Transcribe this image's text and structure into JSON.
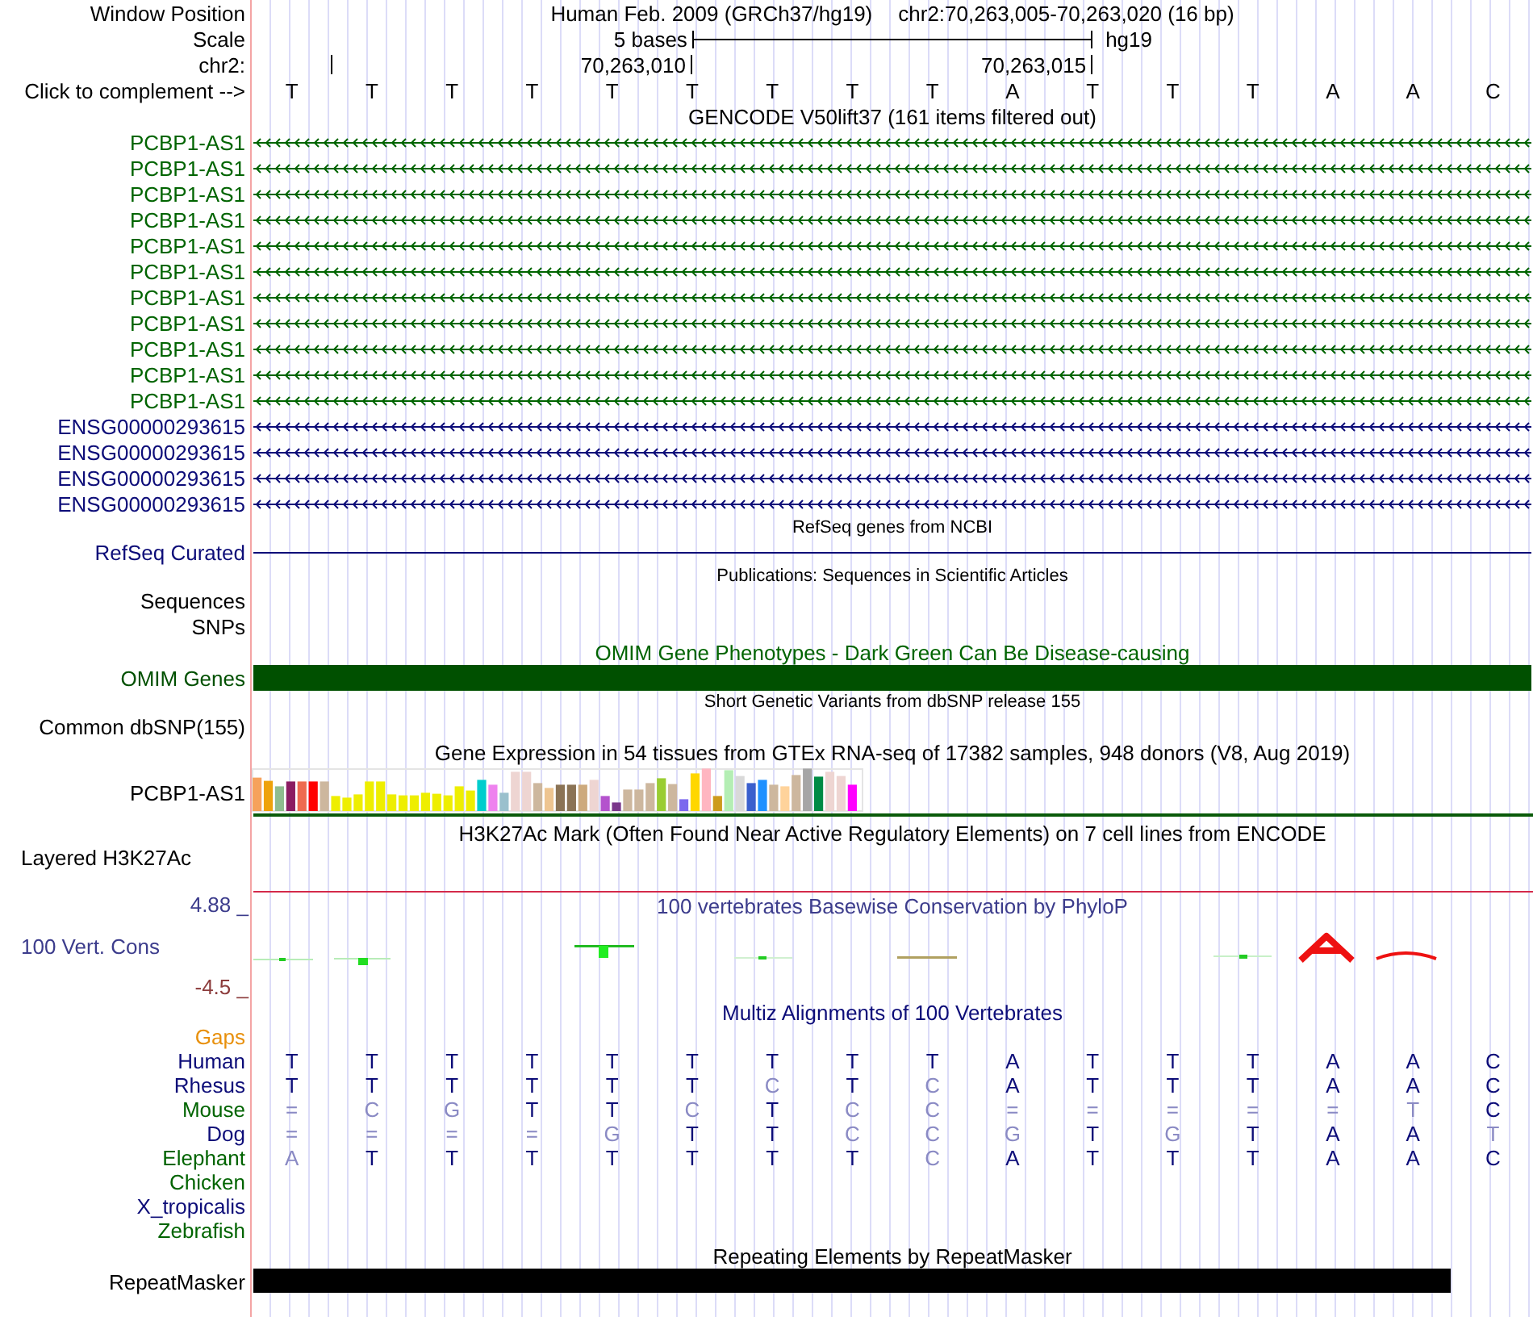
{
  "header": {
    "position_label": "Window Position",
    "assembly": "Human Feb. 2009 (GRCh37/hg19)",
    "position": "chr2:70,263,005-70,263,020 (16 bp)",
    "scale_label": "Scale",
    "scale_text": "5 bases",
    "scale_db": "hg19",
    "ruler_label": "chr2:",
    "ruler_marks": [
      "70,263,010",
      "70,263,015"
    ],
    "complement_label": "Click to complement -->",
    "bases": [
      "T",
      "T",
      "T",
      "T",
      "T",
      "T",
      "T",
      "T",
      "T",
      "A",
      "T",
      "T",
      "T",
      "A",
      "A",
      "C"
    ]
  },
  "tracks": [
    {
      "kind": "gene_list",
      "title": "GENCODE V50lift37 (161 items filtered out)",
      "color": "#000000",
      "rows": [
        {
          "name": "PCBP1-AS1",
          "color": "#006400"
        },
        {
          "name": "PCBP1-AS1",
          "color": "#006400"
        },
        {
          "name": "PCBP1-AS1",
          "color": "#006400"
        },
        {
          "name": "PCBP1-AS1",
          "color": "#006400"
        },
        {
          "name": "PCBP1-AS1",
          "color": "#006400"
        },
        {
          "name": "PCBP1-AS1",
          "color": "#006400"
        },
        {
          "name": "PCBP1-AS1",
          "color": "#006400"
        },
        {
          "name": "PCBP1-AS1",
          "color": "#006400"
        },
        {
          "name": "PCBP1-AS1",
          "color": "#006400"
        },
        {
          "name": "PCBP1-AS1",
          "color": "#006400"
        },
        {
          "name": "PCBP1-AS1",
          "color": "#006400"
        },
        {
          "name": "ENSG00000293615",
          "color": "#0c0c78"
        },
        {
          "name": "ENSG00000293615",
          "color": "#0c0c78"
        },
        {
          "name": "ENSG00000293615",
          "color": "#0c0c78"
        },
        {
          "name": "ENSG00000293615",
          "color": "#0c0c78"
        }
      ]
    },
    {
      "kind": "line",
      "title": "RefSeq genes from NCBI",
      "color": "#000000",
      "rows": [
        {
          "name": "RefSeq Curated",
          "color": "#0c0c78"
        }
      ]
    },
    {
      "kind": "labels",
      "title": "Publications: Sequences in Scientific Articles",
      "color": "#000000",
      "rows": [
        {
          "name": "Sequences",
          "color": "#000000"
        },
        {
          "name": "SNPs",
          "color": "#000000"
        }
      ]
    },
    {
      "kind": "full_bar",
      "title": "OMIM Gene Phenotypes - Dark Green Can Be Disease-causing",
      "color": "#006400",
      "rows": [
        {
          "name": "OMIM Genes",
          "color": "#005000"
        }
      ]
    },
    {
      "kind": "labels",
      "title": "Short Genetic Variants from dbSNP release 155",
      "color": "#000000",
      "rows": [
        {
          "name": "Common dbSNP(155)",
          "color": "#000000"
        }
      ]
    },
    {
      "kind": "expression",
      "title": "Gene Expression in 54 tissues from GTEx RNA-seq of 17382 samples, 948 donors (V8, Aug 2019)",
      "color": "#000000",
      "rows": [
        {
          "name": "PCBP1-AS1",
          "color": "#000000"
        }
      ]
    },
    {
      "kind": "signal",
      "title": "H3K27Ac Mark (Often Found Near Active Regulatory Elements) on 7 cell lines from ENCODE",
      "color": "#000000",
      "rows": [
        {
          "name": "Layered H3K27Ac",
          "color": "#000000"
        }
      ]
    },
    {
      "kind": "conservation",
      "title": "100 vertebrates Basewise Conservation by PhyloP",
      "color": "#3c3c8c",
      "max_label": {
        "text": "4.88 _",
        "color": "#3c3c8c"
      },
      "rows": [
        {
          "name": "100 Vert. Cons",
          "color": "#3c3c8c"
        }
      ],
      "min_label": {
        "text": "-4.5 _",
        "color": "#8c3c3c"
      }
    },
    {
      "kind": "alignment",
      "title": "Multiz Alignments of 100 Vertebrates",
      "color": "#0c0c78",
      "rows": [
        {
          "name": "Gaps",
          "color": "#e8900c"
        },
        {
          "name": "Human",
          "color": "#0c0c78",
          "bases": [
            {
              "base": "T",
              "match": true
            },
            {
              "base": "T",
              "match": true
            },
            {
              "base": "T",
              "match": true
            },
            {
              "base": "T",
              "match": true
            },
            {
              "base": "T",
              "match": true
            },
            {
              "base": "T",
              "match": true
            },
            {
              "base": "T",
              "match": true
            },
            {
              "base": "T",
              "match": true
            },
            {
              "base": "T",
              "match": true
            },
            {
              "base": "A",
              "match": true
            },
            {
              "base": "T",
              "match": true
            },
            {
              "base": "T",
              "match": true
            },
            {
              "base": "T",
              "match": true
            },
            {
              "base": "A",
              "match": true
            },
            {
              "base": "A",
              "match": true
            },
            {
              "base": "C",
              "match": true
            }
          ]
        },
        {
          "name": "Rhesus",
          "color": "#0c0c78",
          "bases": [
            {
              "base": "T",
              "match": true
            },
            {
              "base": "T",
              "match": true
            },
            {
              "base": "T",
              "match": true
            },
            {
              "base": "T",
              "match": true
            },
            {
              "base": "T",
              "match": true
            },
            {
              "base": "T",
              "match": true
            },
            {
              "base": "C",
              "match": false
            },
            {
              "base": "T",
              "match": true
            },
            {
              "base": "C",
              "match": false
            },
            {
              "base": "A",
              "match": true
            },
            {
              "base": "T",
              "match": true
            },
            {
              "base": "T",
              "match": true
            },
            {
              "base": "T",
              "match": true
            },
            {
              "base": "A",
              "match": true
            },
            {
              "base": "A",
              "match": true
            },
            {
              "base": "C",
              "match": true
            }
          ]
        },
        {
          "name": "Mouse",
          "color": "#006400",
          "bases": [
            {
              "base": "=",
              "match": false
            },
            {
              "base": "C",
              "match": false
            },
            {
              "base": "G",
              "match": false
            },
            {
              "base": "T",
              "match": true
            },
            {
              "base": "T",
              "match": true
            },
            {
              "base": "C",
              "match": false
            },
            {
              "base": "T",
              "match": true
            },
            {
              "base": "C",
              "match": false
            },
            {
              "base": "C",
              "match": false
            },
            {
              "base": "=",
              "match": false
            },
            {
              "base": "=",
              "match": false
            },
            {
              "base": "=",
              "match": false
            },
            {
              "base": "=",
              "match": false
            },
            {
              "base": "=",
              "match": false
            },
            {
              "base": "T",
              "match": false
            },
            {
              "base": "C",
              "match": true
            }
          ]
        },
        {
          "name": "Dog",
          "color": "#0c0c78",
          "bases": [
            {
              "base": "=",
              "match": false
            },
            {
              "base": "=",
              "match": false
            },
            {
              "base": "=",
              "match": false
            },
            {
              "base": "=",
              "match": false
            },
            {
              "base": "G",
              "match": false
            },
            {
              "base": "T",
              "match": true
            },
            {
              "base": "T",
              "match": true
            },
            {
              "base": "C",
              "match": false
            },
            {
              "base": "C",
              "match": false
            },
            {
              "base": "G",
              "match": false
            },
            {
              "base": "T",
              "match": true
            },
            {
              "base": "G",
              "match": false
            },
            {
              "base": "T",
              "match": true
            },
            {
              "base": "A",
              "match": true
            },
            {
              "base": "A",
              "match": true
            },
            {
              "base": "T",
              "match": false
            }
          ]
        },
        {
          "name": "Elephant",
          "color": "#006400",
          "bases": [
            {
              "base": "A",
              "match": false
            },
            {
              "base": "T",
              "match": true
            },
            {
              "base": "T",
              "match": true
            },
            {
              "base": "T",
              "match": true
            },
            {
              "base": "T",
              "match": true
            },
            {
              "base": "T",
              "match": true
            },
            {
              "base": "T",
              "match": true
            },
            {
              "base": "T",
              "match": true
            },
            {
              "base": "C",
              "match": false
            },
            {
              "base": "A",
              "match": true
            },
            {
              "base": "T",
              "match": true
            },
            {
              "base": "T",
              "match": true
            },
            {
              "base": "T",
              "match": true
            },
            {
              "base": "A",
              "match": true
            },
            {
              "base": "A",
              "match": true
            },
            {
              "base": "C",
              "match": true
            }
          ]
        },
        {
          "name": "Chicken",
          "color": "#006400"
        },
        {
          "name": "X_tropicalis",
          "color": "#0c0c78"
        },
        {
          "name": "Zebrafish",
          "color": "#006400"
        }
      ]
    },
    {
      "kind": "partial_bar",
      "title": "Repeating Elements by RepeatMasker",
      "color": "#000000",
      "rows": [
        {
          "name": "RepeatMasker",
          "color": "#000000"
        }
      ]
    }
  ]
}
